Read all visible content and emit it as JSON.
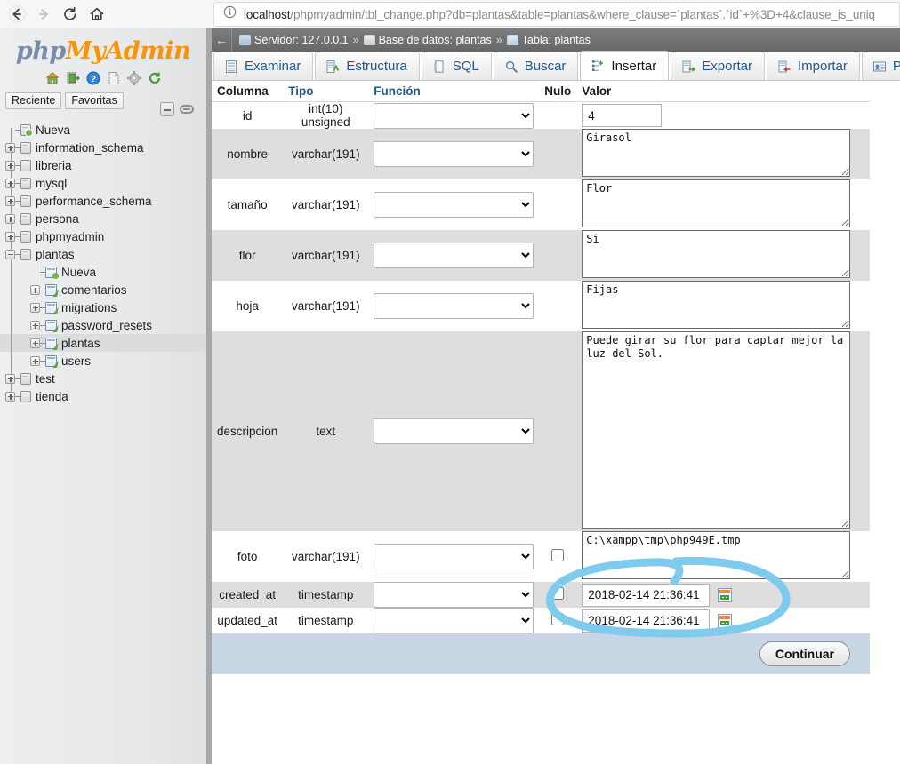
{
  "browser": {
    "back_icon": "back-arrow-icon",
    "forward_icon": "forward-arrow-icon",
    "reload_icon": "reload-icon",
    "home_icon": "home-icon",
    "info_icon": "info-circle-icon",
    "url_host": "localhost",
    "url_path": "/phpmyadmin/tbl_change.php?db=plantas&table=plantas&where_clause=`plantas`.`id`+%3D+4&clause_is_uniq"
  },
  "sidebar": {
    "logo_php": "php",
    "logo_myadmin": "MyAdmin",
    "icons": [
      "home-icon",
      "logout-icon",
      "help-icon",
      "docs-icon",
      "settings-gear-icon",
      "reload-icon"
    ],
    "quick_tabs": [
      {
        "label": "Reciente"
      },
      {
        "label": "Favoritas"
      }
    ],
    "tree_controls": [
      "collapse-all-icon",
      "link-tables-icon"
    ],
    "tree": [
      {
        "label": "Nueva",
        "level": 0,
        "expander": "none",
        "icon": "db-new-icon",
        "selected": false
      },
      {
        "label": "information_schema",
        "level": 0,
        "expander": "plus",
        "icon": "db-icon",
        "selected": false
      },
      {
        "label": "libreria",
        "level": 0,
        "expander": "plus",
        "icon": "db-icon",
        "selected": false
      },
      {
        "label": "mysql",
        "level": 0,
        "expander": "plus",
        "icon": "db-icon",
        "selected": false
      },
      {
        "label": "performance_schema",
        "level": 0,
        "expander": "plus",
        "icon": "db-icon",
        "selected": false
      },
      {
        "label": "persona",
        "level": 0,
        "expander": "plus",
        "icon": "db-icon",
        "selected": false
      },
      {
        "label": "phpmyadmin",
        "level": 0,
        "expander": "plus",
        "icon": "db-icon",
        "selected": false
      },
      {
        "label": "plantas",
        "level": 0,
        "expander": "minus",
        "icon": "db-icon",
        "selected": false
      },
      {
        "label": "Nueva",
        "level": 1,
        "expander": "none",
        "icon": "table-new-icon",
        "selected": false
      },
      {
        "label": "comentarios",
        "level": 1,
        "expander": "plus",
        "icon": "table-icon",
        "selected": false
      },
      {
        "label": "migrations",
        "level": 1,
        "expander": "plus",
        "icon": "table-icon",
        "selected": false
      },
      {
        "label": "password_resets",
        "level": 1,
        "expander": "plus",
        "icon": "table-icon",
        "selected": false
      },
      {
        "label": "plantas",
        "level": 1,
        "expander": "plus",
        "icon": "table-icon",
        "selected": true
      },
      {
        "label": "users",
        "level": 1,
        "expander": "plus",
        "icon": "table-icon",
        "selected": false
      },
      {
        "label": "test",
        "level": 0,
        "expander": "plus",
        "icon": "db-icon",
        "selected": false
      },
      {
        "label": "tienda",
        "level": 0,
        "expander": "plus",
        "icon": "db-icon",
        "selected": false
      }
    ]
  },
  "breadcrumb": {
    "back_arrow": "←",
    "server_label": "Servidor: 127.0.0.1",
    "database_label": "Base de datos: plantas",
    "table_label": "Tabla: plantas",
    "separator": "»"
  },
  "tabs": [
    {
      "label": "Examinar",
      "icon": "browse-icon",
      "active": false
    },
    {
      "label": "Estructura",
      "icon": "structure-icon",
      "active": false
    },
    {
      "label": "SQL",
      "icon": "sql-icon",
      "active": false
    },
    {
      "label": "Buscar",
      "icon": "search-icon",
      "active": false
    },
    {
      "label": "Insertar",
      "icon": "insert-icon",
      "active": true
    },
    {
      "label": "Exportar",
      "icon": "export-icon",
      "active": false
    },
    {
      "label": "Importar",
      "icon": "import-icon",
      "active": false
    },
    {
      "label": "Privileg",
      "icon": "privileges-icon",
      "active": false
    }
  ],
  "form": {
    "headers": {
      "columna": "Columna",
      "tipo": "Tipo",
      "funcion": "Función",
      "nulo": "Nulo",
      "valor": "Valor"
    },
    "rows": [
      {
        "column": "id",
        "type": "int(10) unsigned",
        "function": "",
        "null_checkbox": false,
        "value": "4",
        "input_kind": "text",
        "striped": false
      },
      {
        "column": "nombre",
        "type": "varchar(191)",
        "function": "",
        "null_checkbox": false,
        "value": "Girasol",
        "input_kind": "textarea",
        "striped": true
      },
      {
        "column": "tamaño",
        "type": "varchar(191)",
        "function": "",
        "null_checkbox": false,
        "value": "Flor",
        "input_kind": "textarea",
        "striped": false
      },
      {
        "column": "flor",
        "type": "varchar(191)",
        "function": "",
        "null_checkbox": false,
        "value": "Si",
        "input_kind": "textarea",
        "striped": true
      },
      {
        "column": "hoja",
        "type": "varchar(191)",
        "function": "",
        "null_checkbox": false,
        "value": "Fijas",
        "input_kind": "textarea",
        "striped": false
      },
      {
        "column": "descripcion",
        "type": "text",
        "function": "",
        "null_checkbox": false,
        "value": "Puede girar su flor para captar mejor la luz del Sol.",
        "input_kind": "textarea-tall",
        "striped": true
      },
      {
        "column": "foto",
        "type": "varchar(191)",
        "function": "",
        "null_checkbox": true,
        "value": "C:\\xampp\\tmp\\php949E.tmp",
        "input_kind": "textarea",
        "striped": false
      },
      {
        "column": "created_at",
        "type": "timestamp",
        "function": "",
        "null_checkbox": true,
        "value": "2018-02-14 21:36:41",
        "input_kind": "timestamp",
        "striped": true
      },
      {
        "column": "updated_at",
        "type": "timestamp",
        "function": "",
        "null_checkbox": true,
        "value": "2018-02-14 21:36:41",
        "input_kind": "timestamp",
        "striped": false
      }
    ],
    "submit_label": "Continuar"
  },
  "annotation": {
    "shape": "hand-drawn-ellipse",
    "color": "#7ecbed",
    "target": "foto-value-field"
  }
}
